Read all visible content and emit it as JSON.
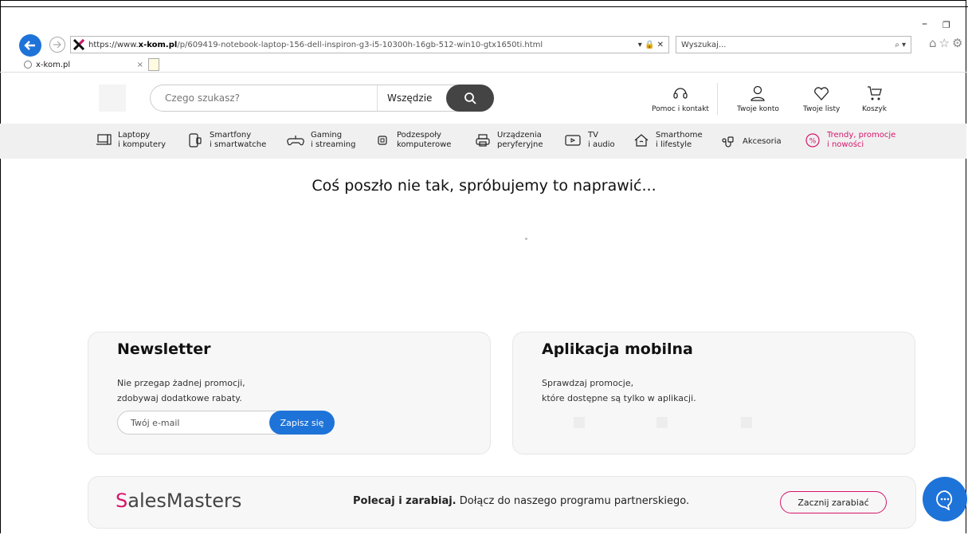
{
  "browser": {
    "url_scheme": "https://www.",
    "url_host": "x-kom.pl",
    "url_path": "/p/609419-notebook-laptop-156-dell-inspiron-g3-i5-10300h-16gb-512-win10-gtx1650ti.html",
    "search_placeholder": "Wyszukaj...",
    "tab_title": "x-kom.pl"
  },
  "header": {
    "search_placeholder": "Czego szukasz?",
    "search_scope": "Wszędzie",
    "help_label": "Pomoc i kontakt",
    "account_label": "Twoje konto",
    "lists_label": "Twoje listy",
    "cart_label": "Koszyk"
  },
  "nav": [
    {
      "line1": "Laptopy",
      "line2": "i komputery"
    },
    {
      "line1": "Smartfony",
      "line2": "i smartwatche"
    },
    {
      "line1": "Gaming",
      "line2": "i streaming"
    },
    {
      "line1": "Podzespoły",
      "line2": "komputerowe"
    },
    {
      "line1": "Urządzenia",
      "line2": "peryferyjne"
    },
    {
      "line1": "TV",
      "line2": "i audio"
    },
    {
      "line1": "Smarthome",
      "line2": "i lifestyle"
    },
    {
      "line1": "Akcesoria",
      "line2": ""
    },
    {
      "line1": "Trendy, promocje",
      "line2": "i nowości"
    }
  ],
  "main": {
    "error_message": "Coś poszło nie tak, spróbujemy to naprawić..."
  },
  "newsletter": {
    "title": "Newsletter",
    "desc_line1": "Nie przegap żadnej promocji,",
    "desc_line2": "zdobywaj dodatkowe rabaty.",
    "email_placeholder": "Twój e-mail",
    "subscribe_label": "Zapisz się"
  },
  "app": {
    "title": "Aplikacja mobilna",
    "desc_line1": "Sprawdzaj promocje,",
    "desc_line2": "które dostępne są tylko w aplikacji."
  },
  "sales": {
    "logo_s": "S",
    "logo_rest": "alesMasters",
    "bold_text": "Polecaj i zarabiaj.",
    "text": " Dołącz do naszego programu partnerskiego.",
    "cta_label": "Zacznij zarabiać"
  },
  "colors": {
    "accent_blue": "#1e73d8",
    "brand_pink": "#d6156b"
  }
}
